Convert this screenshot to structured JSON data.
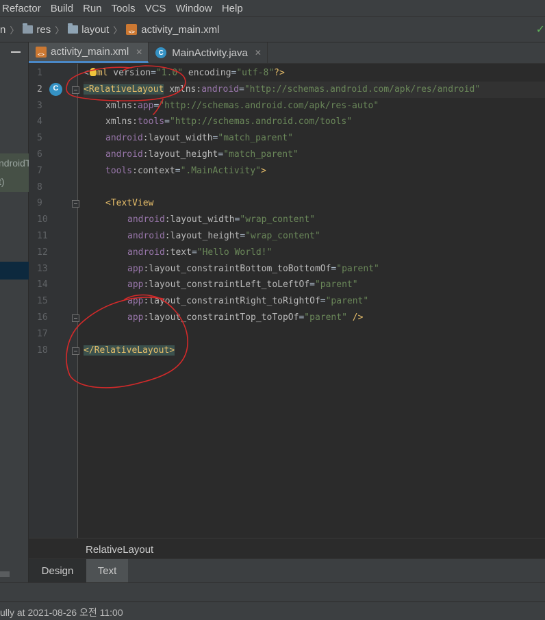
{
  "menu": {
    "items": [
      {
        "label": "Refactor",
        "mnemonic": "R"
      },
      {
        "label": "Build",
        "mnemonic": "B"
      },
      {
        "label": "Run",
        "mnemonic": "u"
      },
      {
        "label": "Tools",
        "mnemonic": "T"
      },
      {
        "label": "VCS",
        "mnemonic": "S"
      },
      {
        "label": "Window",
        "mnemonic": "W"
      },
      {
        "label": "Help",
        "mnemonic": "H"
      }
    ]
  },
  "breadcrumb": {
    "lead": "n",
    "items": [
      {
        "label": "res",
        "icon": "folder-icon"
      },
      {
        "label": "layout",
        "icon": "folder-icon"
      },
      {
        "label": "activity_main.xml",
        "icon": "xml-file-icon"
      }
    ]
  },
  "left_panel": {
    "line1": "ndroidT",
    "line2": "t)"
  },
  "tabs": [
    {
      "label": "activity_main.xml",
      "icon": "xml-file-icon",
      "active": true
    },
    {
      "label": "MainActivity.java",
      "icon": "java-class-icon",
      "active": false
    }
  ],
  "editor": {
    "line_numbers": [
      "1",
      "2",
      "3",
      "4",
      "5",
      "6",
      "7",
      "8",
      "9",
      "10",
      "11",
      "12",
      "13",
      "14",
      "15",
      "16",
      "17",
      "18"
    ],
    "lines": {
      "l1": {
        "pre": "<",
        "bulb_after": "?",
        "rest_tag": "ml",
        "attr1": " version",
        "eq1": "=",
        "val1": "\"1.0\"",
        "attr2": " encoding",
        "eq2": "=",
        "val2": "\"utf-8\"",
        "end": "?>"
      },
      "l2": {
        "tag": "<RelativeLayout",
        "ns": " xmlns",
        "colon": ":",
        "attr": "android",
        "eq": "=",
        "val": "\"http://schemas.android.com/apk/res/android\""
      },
      "l3": {
        "ns": "xmlns",
        "colon": ":",
        "attr": "app",
        "eq": "=",
        "val": "\"http://schemas.android.com/apk/res-auto\""
      },
      "l4": {
        "ns": "xmlns",
        "colon": ":",
        "attr": "tools",
        "eq": "=",
        "val": "\"http://schemas.android.com/tools\""
      },
      "l5": {
        "ns": "android",
        "colon": ":",
        "attr": "layout_width",
        "eq": "=",
        "val": "\"match_parent\""
      },
      "l6": {
        "ns": "android",
        "colon": ":",
        "attr": "layout_height",
        "eq": "=",
        "val": "\"match_parent\""
      },
      "l7": {
        "ns": "tools",
        "colon": ":",
        "attr": "context",
        "eq": "=",
        "val": "\".MainActivity\"",
        "end": ">"
      },
      "l9": {
        "tag": "<TextView"
      },
      "l10": {
        "ns": "android",
        "colon": ":",
        "attr": "layout_width",
        "eq": "=",
        "val": "\"wrap_content\""
      },
      "l11": {
        "ns": "android",
        "colon": ":",
        "attr": "layout_height",
        "eq": "=",
        "val": "\"wrap_content\""
      },
      "l12": {
        "ns": "android",
        "colon": ":",
        "attr": "text",
        "eq": "=",
        "val": "\"Hello World!\""
      },
      "l13": {
        "ns": "app",
        "colon": ":",
        "attr": "layout_constraintBottom_toBottomOf",
        "eq": "=",
        "val": "\"parent\""
      },
      "l14": {
        "ns": "app",
        "colon": ":",
        "attr": "layout_constraintLeft_toLeftOf",
        "eq": "=",
        "val": "\"parent\""
      },
      "l15": {
        "ns": "app",
        "colon": ":",
        "attr": "layout_constraintRight_toRightOf",
        "eq": "=",
        "val": "\"parent\""
      },
      "l16": {
        "ns": "app",
        "colon": ":",
        "attr": "layout_constraintTop_toTopOf",
        "eq": "=",
        "val": "\"parent\"",
        "end": " />"
      },
      "l18": {
        "tag": "</RelativeLayout",
        "end": ">"
      }
    },
    "gutter_class_icon": "C"
  },
  "code_breadcrumb": "RelativeLayout",
  "design_tabs": [
    {
      "label": "Design",
      "active": true
    },
    {
      "label": "Text",
      "active": false
    }
  ],
  "status": {
    "text": "ully at 2021-08-26 오전 11:00"
  },
  "colors": {
    "annotation": "#d42a2a",
    "tag": "#e8bf6a",
    "namespace": "#9876aa",
    "value": "#6a8759",
    "accent": "#4a88c7"
  }
}
